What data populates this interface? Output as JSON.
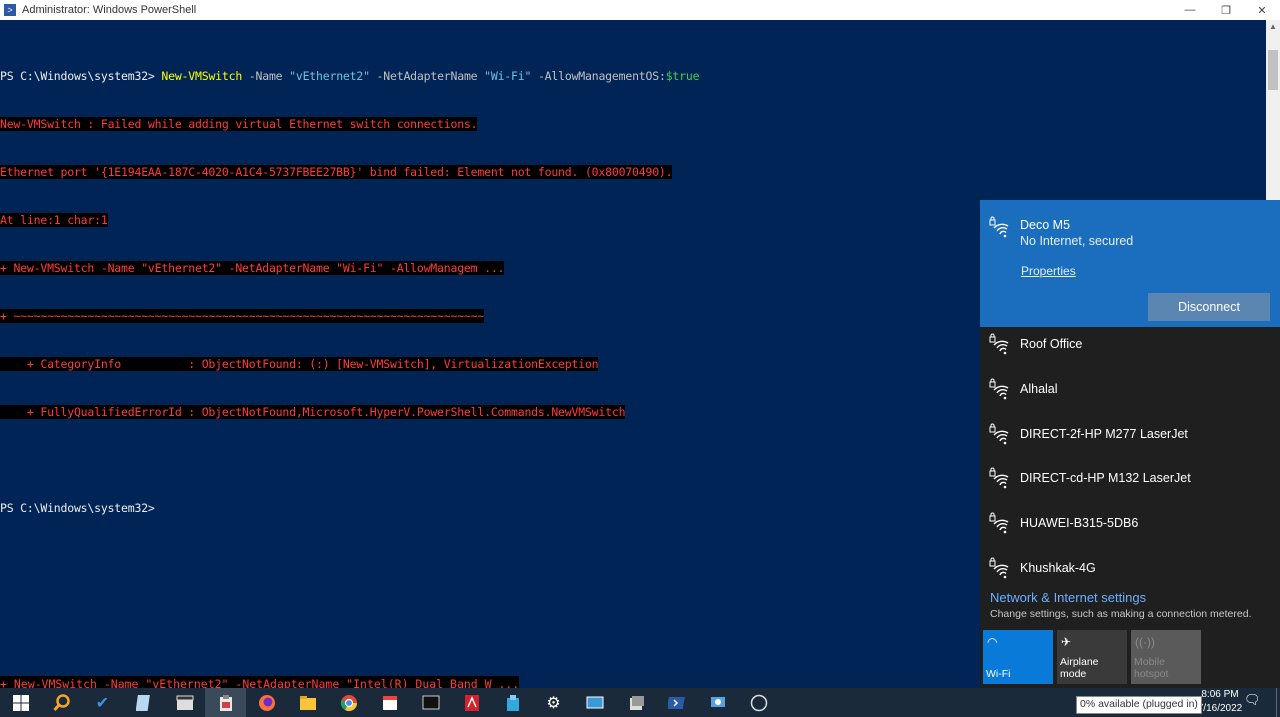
{
  "window": {
    "title": "Administrator: Windows PowerShell",
    "minimize": "—",
    "maximize": "❐",
    "close": "✕"
  },
  "console": {
    "prompt1": "PS C:\\Windows\\system32> ",
    "cmd_name": "New-VMSwitch",
    "param_name": " -Name ",
    "arg_name": "\"vEthernet2\"",
    "param_adapter": " -NetAdapterName ",
    "arg_adapter": "\"Wi-Fi\"",
    "param_mgmt": " -AllowManagementOS:",
    "arg_mgmt": "$true",
    "error_lines": [
      "New-VMSwitch : Failed while adding virtual Ethernet switch connections.",
      "Ethernet port '{1E194EAA-187C-4020-A1C4-5737FBEE27BB}' bind failed: Element not found. (0x80070490).",
      "At line:1 char:1",
      "+ New-VMSwitch -Name \"vEthernet2\" -NetAdapterName \"Wi-Fi\" -AllowManagem ...",
      "+ ~~~~~~~~~~~~~~~~~~~~~~~~~~~~~~~~~~~~~~~~~~~~~~~~~~~~~~~~~~~~~~~~~~~~~~",
      "    + CategoryInfo          : ObjectNotFound: (:) [New-VMSwitch], VirtualizationException",
      "    + FullyQualifiedErrorId : ObjectNotFound,Microsoft.HyperV.PowerShell.Commands.NewVMSwitch"
    ],
    "prompt2": "PS C:\\Windows\\system32>",
    "bottom_error": "+ New-VMSwitch -Name \"vEthernet2\" -NetAdapterName \"Intel(R) Dual Band W ..."
  },
  "wifi": {
    "connected": {
      "name": "Deco M5",
      "status": "No Internet, secured",
      "properties_label": "Properties",
      "disconnect_label": "Disconnect"
    },
    "networks": [
      {
        "name": "Roof Office"
      },
      {
        "name": "Alhalal"
      },
      {
        "name": "DIRECT-2f-HP M277 LaserJet"
      },
      {
        "name": "DIRECT-cd-HP M132 LaserJet"
      },
      {
        "name": "HUAWEI-B315-5DB6"
      },
      {
        "name": "Khushkak-4G"
      }
    ],
    "settings_title": "Network & Internet settings",
    "settings_subtitle": "Change settings, such as making a connection metered.",
    "tiles": [
      {
        "label": "Wi-Fi",
        "icon": "wifi-icon",
        "state": "active"
      },
      {
        "label": "Airplane mode",
        "icon": "airplane-icon",
        "state": "off"
      },
      {
        "label": "Mobile hotspot",
        "icon": "hotspot-icon",
        "state": "disabled"
      }
    ]
  },
  "taskbar": {
    "apps": [
      "windows-start-icon",
      "search-icon",
      "todo-icon",
      "notepad-icon",
      "clapper-icon",
      "clipboard-icon",
      "firefox-icon",
      "file-explorer-icon",
      "chrome-icon",
      "calendar-icon",
      "terminal-icon",
      "acrobat-icon",
      "app-icon",
      "settings-icon",
      "remote-desktop-icon",
      "server-icon",
      "powershell-icon",
      "network-icon",
      "circle-icon"
    ],
    "time": "8:06 PM",
    "date": "7/16/2022",
    "battery_tooltip": "0% available (plugged in)"
  }
}
